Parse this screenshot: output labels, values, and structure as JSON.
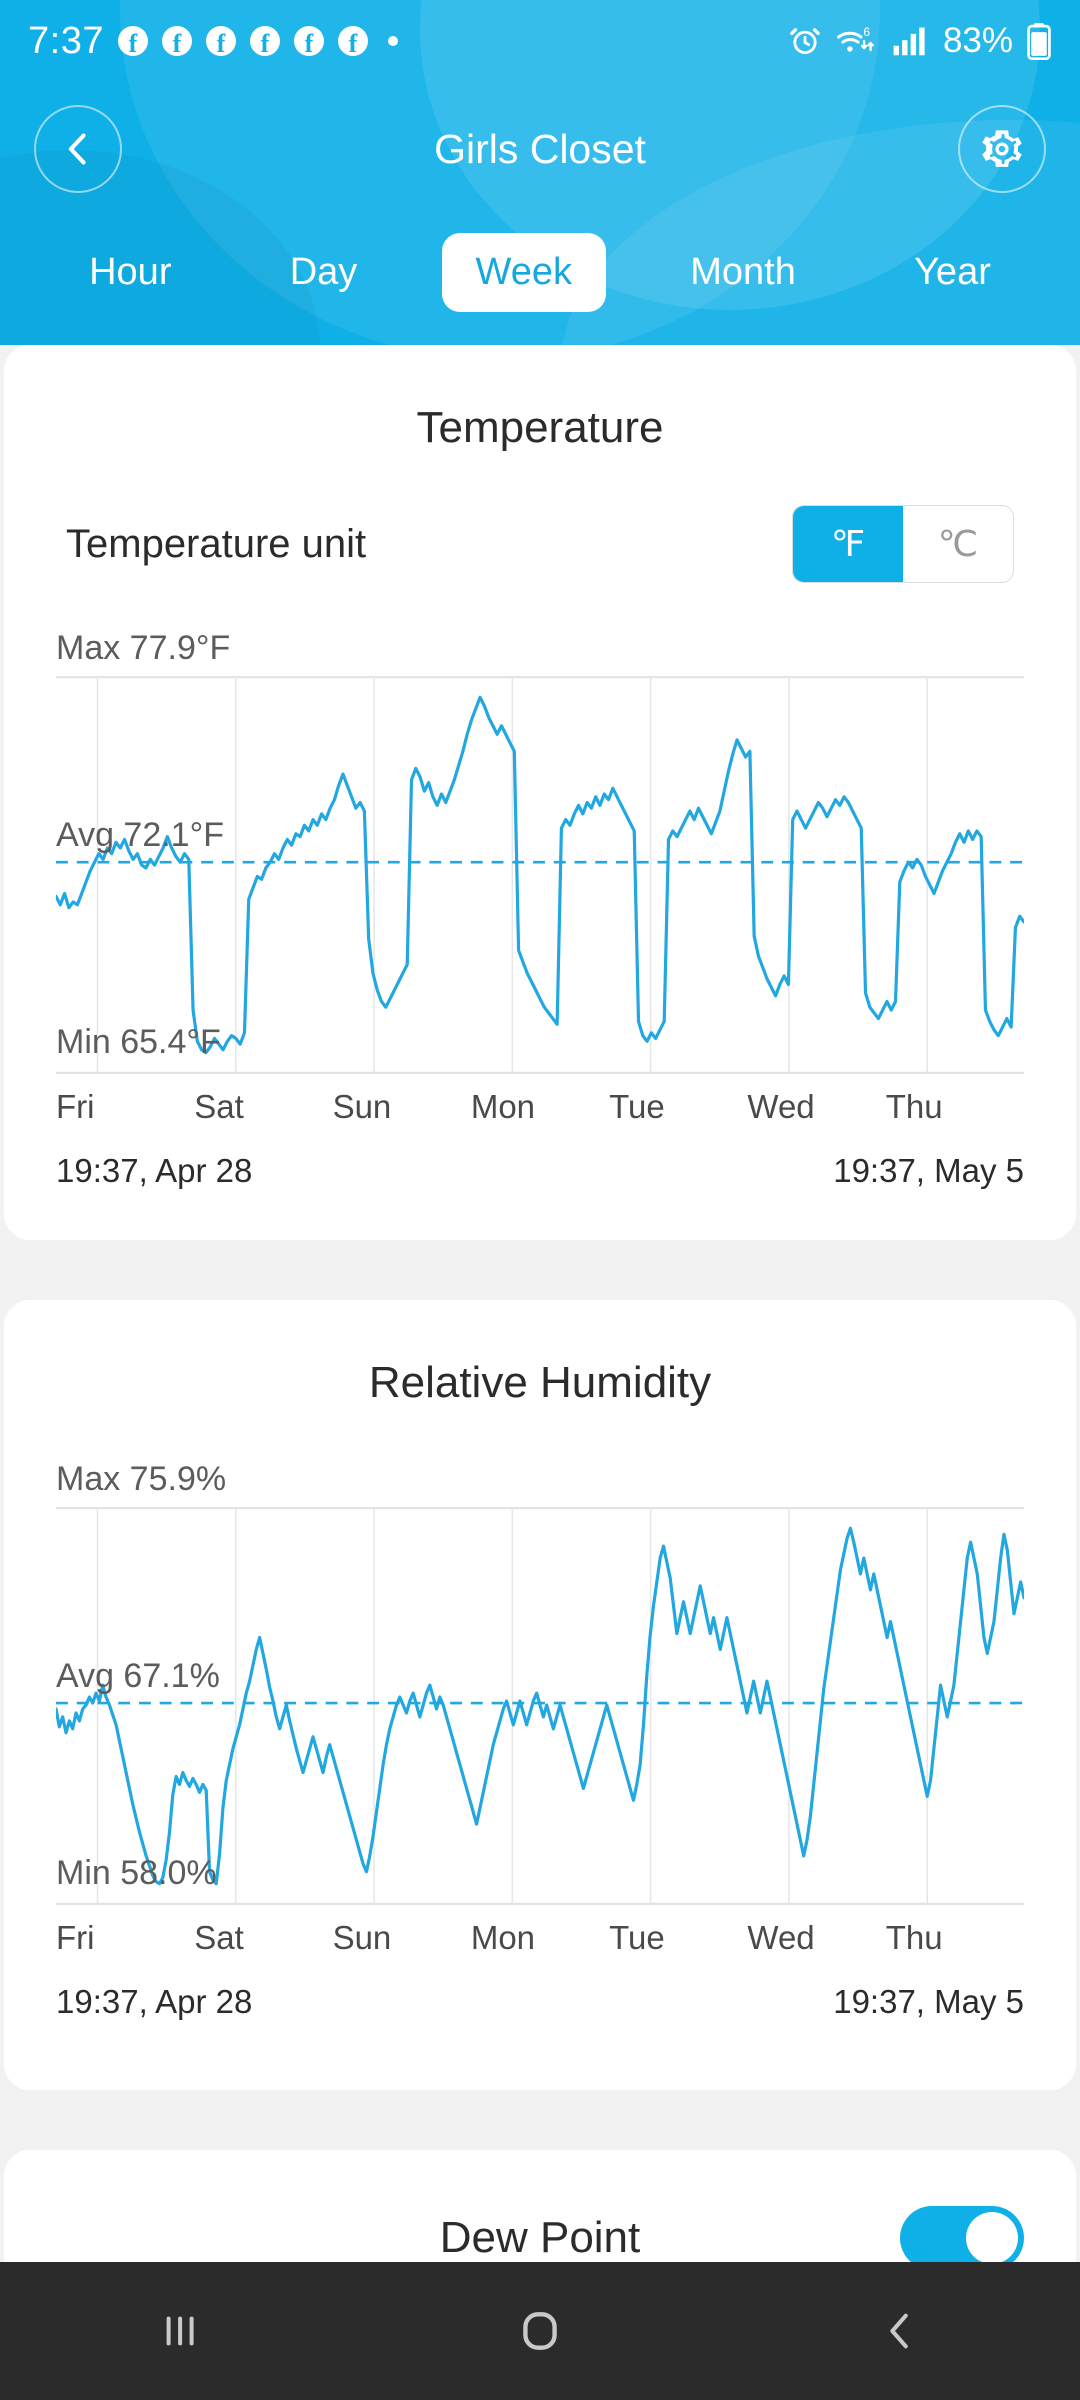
{
  "statusbar": {
    "time": "7:37",
    "notification_icons": [
      "facebook-icon",
      "facebook-icon",
      "facebook-icon",
      "facebook-icon",
      "facebook-icon",
      "facebook-icon",
      "dot-icon"
    ],
    "alarm_icon": "alarm-icon",
    "wifi_icon": "wifi-6-icon",
    "signal_icon": "signal-bars-icon",
    "battery_percent": "83%",
    "battery_icon": "battery-icon"
  },
  "header": {
    "back_icon": "chevron-left-icon",
    "title": "Girls Closet",
    "settings_icon": "gear-icon",
    "brand_blue": "#0fb0e8"
  },
  "tabs": [
    {
      "label": "Hour",
      "active": false
    },
    {
      "label": "Day",
      "active": false
    },
    {
      "label": "Week",
      "active": true
    },
    {
      "label": "Month",
      "active": false
    },
    {
      "label": "Year",
      "active": false
    }
  ],
  "temperature_card": {
    "title": "Temperature",
    "unit_label": "Temperature unit",
    "unit_options": [
      "℉",
      "℃"
    ],
    "unit_selected": "℉"
  },
  "humidity_card": {
    "title": "Relative Humidity"
  },
  "dew_card": {
    "title": "Dew Point",
    "toggle_on": true
  },
  "navbar": {
    "recents_icon": "recents-icon",
    "home_icon": "home-icon",
    "back_icon": "back-icon"
  },
  "chart_data": [
    {
      "type": "line",
      "title": "Temperature",
      "id": "temperature",
      "ylabel": "°F",
      "xlabel": "",
      "max_label": "Max 77.9°F",
      "avg_label": "Avg 72.1°F",
      "min_label": "Min 65.4°F",
      "max": 77.9,
      "avg": 72.1,
      "min": 65.4,
      "ylim": [
        65.4,
        77.9
      ],
      "grid": true,
      "legend": "none",
      "avg_line": true,
      "unit": "°F",
      "categories": [
        "Fri",
        "Sat",
        "Sun",
        "Mon",
        "Tue",
        "Wed",
        "Thu"
      ],
      "range_start": "19:37,  Apr 28",
      "range_end": "19:37,  May 5",
      "line_color": "#22a7e0",
      "values": [
        70.9,
        70.6,
        71.0,
        70.5,
        70.7,
        70.6,
        71.0,
        71.4,
        71.8,
        72.1,
        72.4,
        72.2,
        72.6,
        72.4,
        72.8,
        72.6,
        72.9,
        72.5,
        72.2,
        72.4,
        72.0,
        71.9,
        72.2,
        72.0,
        72.3,
        72.6,
        73.0,
        72.6,
        72.3,
        72.1,
        72.4,
        72.2,
        66.9,
        65.8,
        65.5,
        65.4,
        65.6,
        65.9,
        65.7,
        65.5,
        65.8,
        66.0,
        65.9,
        65.7,
        66.1,
        70.8,
        71.2,
        71.6,
        71.5,
        71.9,
        72.1,
        72.4,
        72.2,
        72.6,
        72.9,
        72.7,
        73.1,
        73.0,
        73.4,
        73.2,
        73.6,
        73.4,
        73.8,
        73.6,
        74.0,
        74.3,
        74.8,
        75.2,
        74.8,
        74.4,
        74.0,
        74.2,
        73.9,
        69.4,
        68.2,
        67.6,
        67.2,
        67.0,
        67.3,
        67.6,
        67.9,
        68.2,
        68.5,
        75.0,
        75.4,
        75.1,
        74.6,
        74.9,
        74.4,
        74.1,
        74.5,
        74.2,
        74.6,
        75.0,
        75.5,
        76.0,
        76.6,
        77.1,
        77.5,
        77.9,
        77.6,
        77.2,
        76.9,
        76.6,
        76.9,
        76.6,
        76.3,
        76.0,
        69.0,
        68.6,
        68.2,
        67.9,
        67.6,
        67.3,
        67.0,
        66.8,
        66.6,
        66.4,
        73.3,
        73.6,
        73.4,
        73.8,
        74.1,
        73.8,
        74.2,
        74.0,
        74.4,
        74.1,
        74.5,
        74.3,
        74.7,
        74.4,
        74.1,
        73.8,
        73.5,
        73.2,
        66.5,
        66.0,
        65.8,
        66.1,
        65.9,
        66.2,
        66.5,
        72.9,
        73.2,
        73.0,
        73.3,
        73.6,
        73.9,
        73.6,
        74.0,
        73.7,
        73.4,
        73.1,
        73.5,
        73.9,
        74.6,
        75.3,
        75.9,
        76.4,
        76.1,
        75.8,
        76.0,
        69.5,
        68.8,
        68.4,
        68.0,
        67.7,
        67.4,
        67.8,
        68.1,
        67.8,
        73.6,
        73.9,
        73.6,
        73.3,
        73.6,
        73.9,
        74.2,
        74.0,
        73.7,
        74.0,
        74.3,
        74.1,
        74.4,
        74.2,
        73.9,
        73.6,
        73.3,
        67.5,
        67.0,
        66.8,
        66.6,
        66.9,
        67.2,
        66.9,
        67.2,
        71.4,
        71.8,
        72.1,
        71.9,
        72.2,
        72.0,
        71.6,
        71.3,
        71.0,
        71.4,
        71.8,
        72.1,
        72.4,
        72.8,
        73.1,
        72.8,
        73.2,
        72.9,
        73.2,
        73.0,
        66.9,
        66.5,
        66.2,
        66.0,
        66.3,
        66.6,
        66.3,
        69.8,
        70.2,
        70.0
      ]
    },
    {
      "type": "line",
      "title": "Relative Humidity",
      "id": "humidity",
      "ylabel": "%",
      "xlabel": "",
      "max_label": "Max 75.9%",
      "avg_label": "Avg 67.1%",
      "min_label": "Min 58.0%",
      "max": 75.9,
      "avg": 67.1,
      "min": 58.0,
      "ylim": [
        58.0,
        75.9
      ],
      "grid": true,
      "legend": "none",
      "avg_line": true,
      "unit": "%",
      "categories": [
        "Fri",
        "Sat",
        "Sun",
        "Mon",
        "Tue",
        "Wed",
        "Thu"
      ],
      "range_start": "19:37,  Apr 28",
      "range_end": "19:37,  May 5",
      "line_color": "#22a7e0",
      "values": [
        66.8,
        65.9,
        66.4,
        65.6,
        66.2,
        65.8,
        66.6,
        66.2,
        66.8,
        67.0,
        67.4,
        67.1,
        67.6,
        67.2,
        68.0,
        67.4,
        67.0,
        66.5,
        66.0,
        65.2,
        64.4,
        63.6,
        62.8,
        62.0,
        61.3,
        60.6,
        60.0,
        59.4,
        58.9,
        58.4,
        58.1,
        58.0,
        58.3,
        59.2,
        60.6,
        62.5,
        63.4,
        63.0,
        63.6,
        63.2,
        62.9,
        63.3,
        63.0,
        62.6,
        63.0,
        62.7,
        58.6,
        58.2,
        58.0,
        59.5,
        61.8,
        63.2,
        64.0,
        64.8,
        65.4,
        66.0,
        66.8,
        67.6,
        68.2,
        69.0,
        69.8,
        70.4,
        69.6,
        68.8,
        67.9,
        67.2,
        66.4,
        65.8,
        66.4,
        67.0,
        66.2,
        65.5,
        64.8,
        64.2,
        63.6,
        64.2,
        64.8,
        65.4,
        64.8,
        64.2,
        63.6,
        64.4,
        65.0,
        64.4,
        63.8,
        63.2,
        62.6,
        62.0,
        61.4,
        60.8,
        60.2,
        59.6,
        59.0,
        58.6,
        59.4,
        60.4,
        61.6,
        62.8,
        64.0,
        65.0,
        65.8,
        66.4,
        67.0,
        67.4,
        67.0,
        66.6,
        67.2,
        67.6,
        67.0,
        66.4,
        67.0,
        67.6,
        68.0,
        67.4,
        66.8,
        67.4,
        67.0,
        66.4,
        65.8,
        65.2,
        64.6,
        64.0,
        63.4,
        62.8,
        62.2,
        61.6,
        61.0,
        61.8,
        62.6,
        63.4,
        64.2,
        65.0,
        65.6,
        66.2,
        66.8,
        67.2,
        66.6,
        66.0,
        66.6,
        67.2,
        66.6,
        66.0,
        66.6,
        67.2,
        67.6,
        67.0,
        66.4,
        67.0,
        66.4,
        65.8,
        66.4,
        67.0,
        66.4,
        65.8,
        65.2,
        64.6,
        64.0,
        63.4,
        62.8,
        63.4,
        64.0,
        64.6,
        65.2,
        65.8,
        66.4,
        67.0,
        66.4,
        65.8,
        65.2,
        64.6,
        64.0,
        63.4,
        62.8,
        62.2,
        63.0,
        64.0,
        66.0,
        68.5,
        70.5,
        72.0,
        73.2,
        74.4,
        75.0,
        74.2,
        73.4,
        72.0,
        70.6,
        71.4,
        72.2,
        71.4,
        70.6,
        71.4,
        72.2,
        73.0,
        72.2,
        71.4,
        70.6,
        71.4,
        70.6,
        69.8,
        70.6,
        71.4,
        70.6,
        69.8,
        69.0,
        68.2,
        67.4,
        66.6,
        67.4,
        68.2,
        67.4,
        66.6,
        67.4,
        68.2,
        67.4,
        66.6,
        65.8,
        65.0,
        64.2,
        63.4,
        62.6,
        61.8,
        61.0,
        60.2,
        59.4,
        60.2,
        61.4,
        63.0,
        64.6,
        66.2,
        67.8,
        69.0,
        70.2,
        71.4,
        72.6,
        73.8,
        74.6,
        75.4,
        75.9,
        75.2,
        74.4,
        73.6,
        74.4,
        73.6,
        72.8,
        73.6,
        72.8,
        72.0,
        71.2,
        70.4,
        71.2,
        70.4,
        69.6,
        68.8,
        68.0,
        67.2,
        66.4,
        65.6,
        64.8,
        64.0,
        63.2,
        62.4,
        63.2,
        64.8,
        66.4,
        68.0,
        67.2,
        66.4,
        67.2,
        68.0,
        69.6,
        71.2,
        72.8,
        74.4,
        75.2,
        74.4,
        73.6,
        72.0,
        70.4,
        69.6,
        70.4,
        71.2,
        72.8,
        74.4,
        75.6,
        74.8,
        73.2,
        71.6,
        72.4,
        73.2,
        72.4
      ]
    }
  ]
}
